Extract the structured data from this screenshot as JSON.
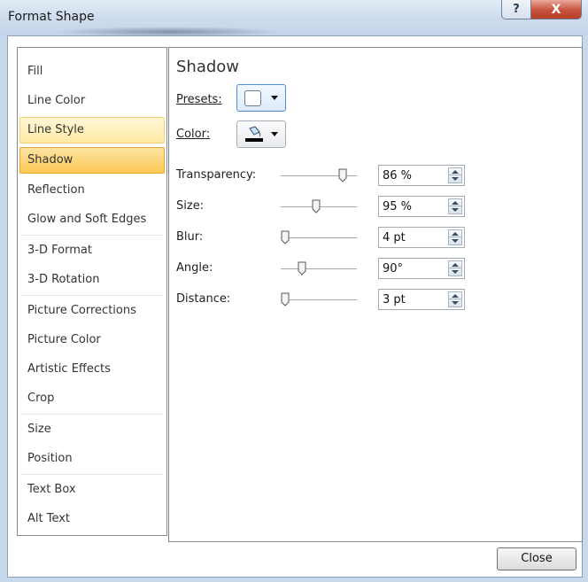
{
  "window": {
    "title": "Format Shape",
    "help_glyph": "?",
    "close_glyph": "X"
  },
  "nav": {
    "items": [
      {
        "label": "Fill"
      },
      {
        "label": "Line Color"
      },
      {
        "label": "Line Style",
        "state": "hover"
      },
      {
        "label": "Shadow",
        "state": "selected"
      },
      {
        "label": "Reflection"
      },
      {
        "label": "Glow and Soft Edges"
      },
      {
        "label": "3-D Format"
      },
      {
        "label": "3-D Rotation"
      },
      {
        "label": "Picture Corrections"
      },
      {
        "label": "Picture Color"
      },
      {
        "label": "Artistic Effects"
      },
      {
        "label": "Crop"
      },
      {
        "label": "Size"
      },
      {
        "label": "Position"
      },
      {
        "label": "Text Box"
      },
      {
        "label": "Alt Text"
      }
    ]
  },
  "shadow": {
    "heading": "Shadow",
    "presets_label": "Presets:",
    "color_label": "Color:",
    "properties": [
      {
        "label": "Transparency:",
        "value": "86 %",
        "level": 0.86
      },
      {
        "label": "Size:",
        "value": "95 %",
        "level": 0.46
      },
      {
        "label": "Blur:",
        "value": "4 pt",
        "level": 0.0
      },
      {
        "label": "Angle:",
        "value": "90°",
        "level": 0.25
      },
      {
        "label": "Distance:",
        "value": "3 pt",
        "level": 0.0
      }
    ]
  },
  "footer": {
    "close_label": "Close"
  },
  "colors": {
    "selected_bg": "#fbc955",
    "hover_bg": "#ffe9a4",
    "focus_border": "#4f8fd6",
    "close_btn_red": "#c8513b"
  }
}
